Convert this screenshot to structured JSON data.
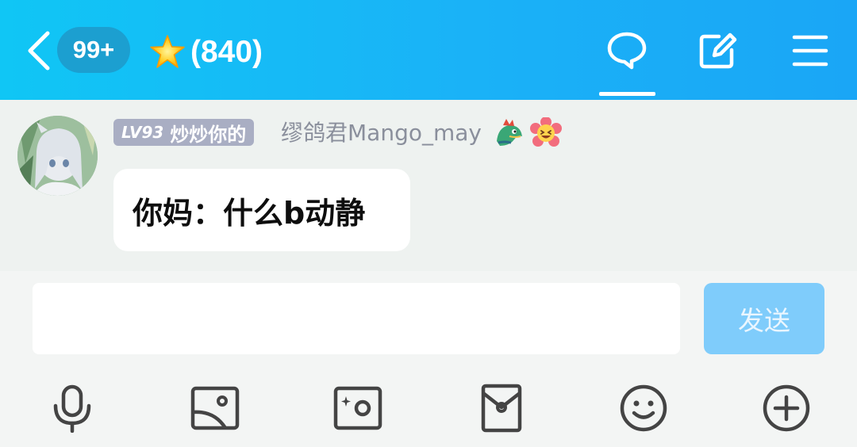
{
  "header": {
    "unread_badge": "99+",
    "star_icon": "glowing-star-emoji",
    "member_count": "(840)",
    "background": "#18b4f6"
  },
  "message": {
    "level": "LV93",
    "title": "炒炒你的",
    "sender": "缪鸽君Mango_may",
    "emojis": [
      "dragon-emoji",
      "smiling-flower-emoji"
    ],
    "text": "你妈：什么b动静"
  },
  "composer": {
    "input_value": "",
    "send_label": "发送",
    "send_color": "#7fccfb",
    "tools": [
      "microphone-icon",
      "image-icon",
      "camera-icon",
      "red-packet-icon",
      "emoji-icon",
      "plus-icon"
    ]
  }
}
